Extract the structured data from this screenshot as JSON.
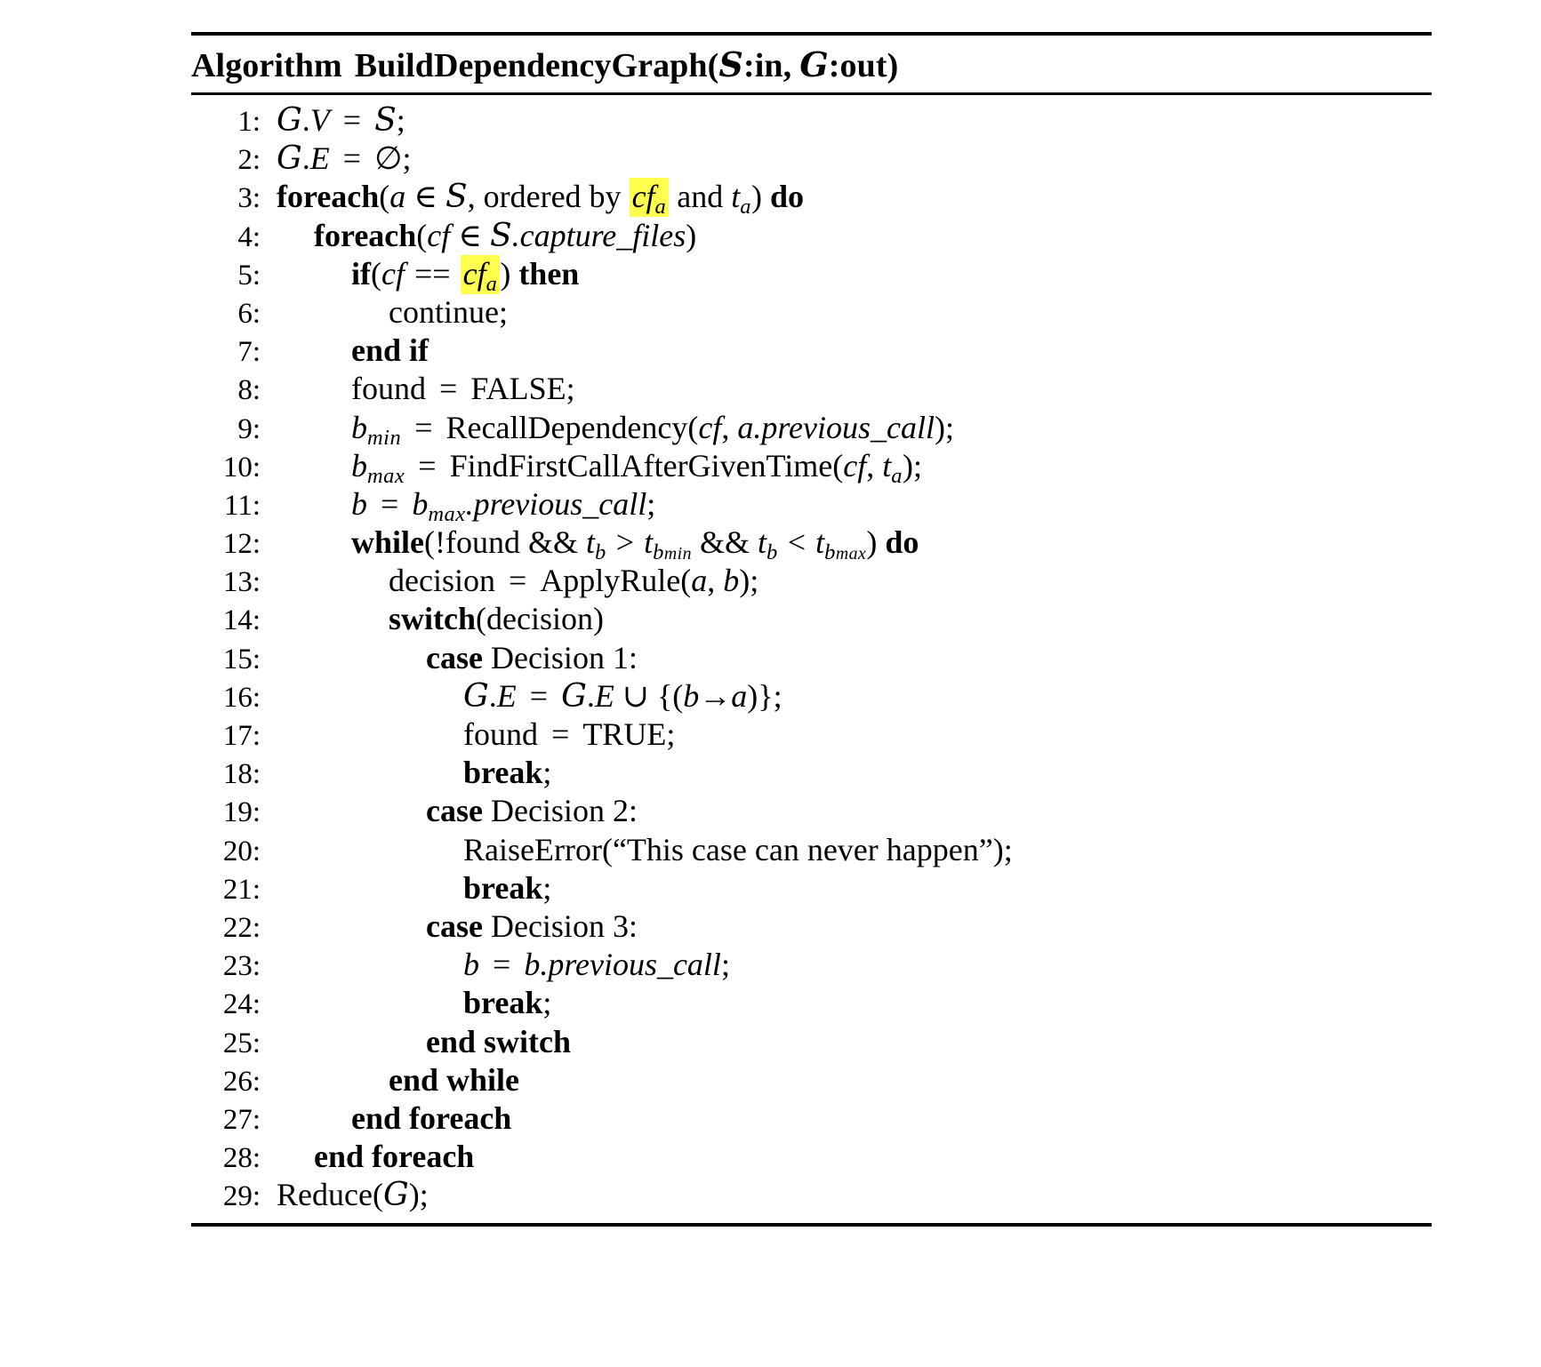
{
  "figure": {
    "title_prefix": "Algorithm",
    "title_name": "BuildDependencyGraph",
    "title_args_open": "(",
    "title_arg1_sym": "S",
    "title_arg1_mode": ":in,",
    "title_arg2_sym": "G",
    "title_arg2_mode": ":out",
    "title_args_close": ")",
    "highlight_color": "#ffff4d",
    "rule_color": "#000000",
    "background_color": "#ffffff"
  },
  "lines": [
    {
      "no": "1:",
      "indent": 0,
      "text": "G.V = S;"
    },
    {
      "no": "2:",
      "indent": 0,
      "text": "G.E = ∅;"
    },
    {
      "no": "3:",
      "indent": 0,
      "text": "foreach(a ∈ S, ordered by cf_a and t_a) do"
    },
    {
      "no": "4:",
      "indent": 1,
      "text": "foreach(cf ∈ S.capture_files)"
    },
    {
      "no": "5:",
      "indent": 2,
      "text": "if(cf == cf_a) then"
    },
    {
      "no": "6:",
      "indent": 3,
      "text": "continue;"
    },
    {
      "no": "7:",
      "indent": 2,
      "text": "end if"
    },
    {
      "no": "8:",
      "indent": 2,
      "text": "found = FALSE;"
    },
    {
      "no": "9:",
      "indent": 2,
      "text": "b_min = RecallDependency(cf, a.previous_call);"
    },
    {
      "no": "10:",
      "indent": 2,
      "text": "b_max = FindFirstCallAfterGivenTime(cf, t_a);"
    },
    {
      "no": "11:",
      "indent": 2,
      "text": "b = b_max.previous_call;"
    },
    {
      "no": "12:",
      "indent": 2,
      "text": "while(!found && t_b > t_b_min && t_b < t_b_max) do"
    },
    {
      "no": "13:",
      "indent": 3,
      "text": "decision = ApplyRule(a, b);"
    },
    {
      "no": "14:",
      "indent": 3,
      "text": "switch(decision)"
    },
    {
      "no": "15:",
      "indent": 4,
      "text": "case Decision 1:"
    },
    {
      "no": "16:",
      "indent": 5,
      "text": "G.E = G.E ∪ {(b→a)};"
    },
    {
      "no": "17:",
      "indent": 5,
      "text": "found = TRUE;"
    },
    {
      "no": "18:",
      "indent": 5,
      "text": "break;"
    },
    {
      "no": "19:",
      "indent": 4,
      "text": "case Decision 2:"
    },
    {
      "no": "20:",
      "indent": 5,
      "text": "RaiseError(“This case can never happen”);"
    },
    {
      "no": "21:",
      "indent": 5,
      "text": "break;"
    },
    {
      "no": "22:",
      "indent": 4,
      "text": "case Decision 3:"
    },
    {
      "no": "23:",
      "indent": 5,
      "text": "b = b.previous_call;"
    },
    {
      "no": "24:",
      "indent": 5,
      "text": "break;"
    },
    {
      "no": "25:",
      "indent": 4,
      "text": "end switch"
    },
    {
      "no": "26:",
      "indent": 3,
      "text": "end while"
    },
    {
      "no": "27:",
      "indent": 2,
      "text": "end foreach"
    },
    {
      "no": "28:",
      "indent": 1,
      "text": "end foreach"
    },
    {
      "no": "29:",
      "indent": 0,
      "text": "Reduce(G);"
    }
  ],
  "tokens": {
    "cal_S": "S",
    "cal_G": "G",
    "empty_set": "∅",
    "elem_of": "∈",
    "union": "∪",
    "arrow": "→",
    "eq": "=",
    "eqeq": "==",
    "gt": ">",
    "lt": "<",
    "and_and": "&&",
    "not": "!",
    "semi": ";",
    "colon": ":",
    "comma": ",",
    "paren_open": "(",
    "paren_close": ")",
    "brace_open": "{",
    "brace_close": "}",
    "dot": ".",
    "kw_foreach": "foreach",
    "kw_do": "do",
    "kw_if": "if",
    "kw_then": "then",
    "kw_end_if": "end if",
    "kw_while": "while",
    "kw_switch": "switch",
    "kw_case": "case",
    "kw_break": "break",
    "kw_end_switch": "end switch",
    "kw_end_while": "end while",
    "kw_end_foreach": "end foreach",
    "word_ordered_by": "ordered by",
    "word_and": "and",
    "word_continue": "continue",
    "word_found": "found",
    "word_FALSE": "FALSE",
    "word_TRUE": "TRUE",
    "word_decision": "decision",
    "word_Decision": "Decision",
    "num_1": "1",
    "num_2": "2",
    "num_3": "3",
    "var_a": "a",
    "var_b": "b",
    "var_t": "t",
    "var_cf": "cf",
    "sub_a": "a",
    "sub_b": "b",
    "sub_min": "min",
    "sub_max": "max",
    "prop_capture_files": "capture_files",
    "prop_previous_call": "previous_call",
    "fn_RecallDependency": "RecallDependency",
    "fn_FindFirstCallAfterGivenTime": "FindFirstCallAfterGivenTime",
    "fn_ApplyRule": "ApplyRule",
    "fn_RaiseError": "RaiseError",
    "fn_Reduce": "Reduce",
    "str_never_happen": "“This case can never happen”",
    "V": "V",
    "E": "E"
  },
  "line_numbers": [
    "1:",
    "2:",
    "3:",
    "4:",
    "5:",
    "6:",
    "7:",
    "8:",
    "9:",
    "10:",
    "11:",
    "12:",
    "13:",
    "14:",
    "15:",
    "16:",
    "17:",
    "18:",
    "19:",
    "20:",
    "21:",
    "22:",
    "23:",
    "24:",
    "25:",
    "26:",
    "27:",
    "28:",
    "29:"
  ]
}
